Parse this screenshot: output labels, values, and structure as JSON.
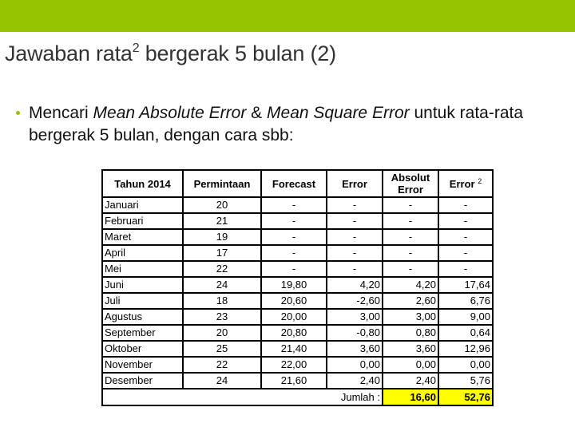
{
  "header": {
    "bar_color": "#94c400",
    "title_main": "Jawaban rata",
    "title_sup": "2",
    "title_rest": " bergerak 5 bulan (2)"
  },
  "bullet": {
    "text_1": "Mencari ",
    "italic_1": "Mean Absolute Error",
    "text_2": " & ",
    "italic_2": "Mean Square Error",
    "text_3": " untuk rata-rata bergerak 5 bulan, dengan cara sbb:"
  },
  "table": {
    "headers": {
      "tahun": "Tahun 2014",
      "permintaan": "Permintaan",
      "forecast": "Forecast",
      "error": "Error",
      "absolut_line1": "Absolut",
      "absolut_line2": "Error",
      "error2": "Error",
      "error2_sup": "2"
    },
    "rows": [
      {
        "month": "Januari",
        "demand": "20",
        "forecast": "-",
        "error": "-",
        "abs_error": "-",
        "sq_error": "-"
      },
      {
        "month": "Februari",
        "demand": "21",
        "forecast": "-",
        "error": "-",
        "abs_error": "-",
        "sq_error": "-"
      },
      {
        "month": "Maret",
        "demand": "19",
        "forecast": "-",
        "error": "-",
        "abs_error": "-",
        "sq_error": "-"
      },
      {
        "month": "April",
        "demand": "17",
        "forecast": "-",
        "error": "-",
        "abs_error": "-",
        "sq_error": "-"
      },
      {
        "month": "Mei",
        "demand": "22",
        "forecast": "-",
        "error": "-",
        "abs_error": "-",
        "sq_error": "-"
      },
      {
        "month": "Juni",
        "demand": "24",
        "forecast": "19,80",
        "error": "4,20",
        "abs_error": "4,20",
        "sq_error": "17,64"
      },
      {
        "month": "Juli",
        "demand": "18",
        "forecast": "20,60",
        "error": "-2,60",
        "abs_error": "2,60",
        "sq_error": "6,76"
      },
      {
        "month": "Agustus",
        "demand": "23",
        "forecast": "20,00",
        "error": "3,00",
        "abs_error": "3,00",
        "sq_error": "9,00"
      },
      {
        "month": "September",
        "demand": "20",
        "forecast": "20,80",
        "error": "-0,80",
        "abs_error": "0,80",
        "sq_error": "0,64"
      },
      {
        "month": "Oktober",
        "demand": "25",
        "forecast": "21,40",
        "error": "3,60",
        "abs_error": "3,60",
        "sq_error": "12,96"
      },
      {
        "month": "November",
        "demand": "22",
        "forecast": "22,00",
        "error": "0,00",
        "abs_error": "0,00",
        "sq_error": "0,00"
      },
      {
        "month": "Desember",
        "demand": "24",
        "forecast": "21,60",
        "error": "2,40",
        "abs_error": "2,40",
        "sq_error": "5,76"
      }
    ],
    "sum_label": "Jumlah :",
    "sum_abs_error": "16,60",
    "sum_sq_error": "52,76",
    "highlight_color": "#ffff00"
  }
}
